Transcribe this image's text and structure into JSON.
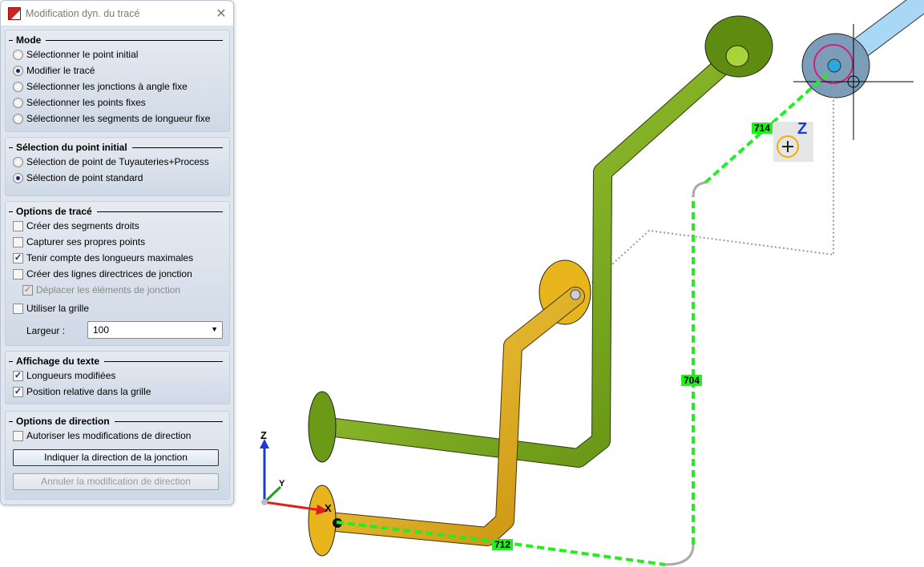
{
  "dialog": {
    "title": "Modification dyn. du tracé",
    "close_icon": "close-icon"
  },
  "mode": {
    "title": "Mode",
    "options": [
      {
        "label": "Sélectionner le point initial",
        "selected": false
      },
      {
        "label": "Modifier le tracé",
        "selected": true
      },
      {
        "label": "Sélectionner les jonctions à angle fixe",
        "selected": false
      },
      {
        "label": "Sélectionner les points fixes",
        "selected": false
      },
      {
        "label": "Sélectionner les segments de longueur fixe",
        "selected": false
      }
    ]
  },
  "initial_point": {
    "title": "Sélection du point initial",
    "options": [
      {
        "label": "Sélection de point de Tuyauteries+Process",
        "selected": false
      },
      {
        "label": "Sélection de point standard",
        "selected": true
      }
    ]
  },
  "route_options": {
    "title": "Options de tracé",
    "checkboxes": [
      {
        "label": "Créer des segments droits",
        "checked": false
      },
      {
        "label": "Capturer ses propres points",
        "checked": false
      },
      {
        "label": "Tenir compte des longueurs maximales",
        "checked": true
      },
      {
        "label": "Créer des lignes directrices de jonction",
        "checked": false
      },
      {
        "label": "Déplacer les éléments de jonction",
        "checked": true,
        "disabled": true
      },
      {
        "label": "Utiliser la grille",
        "checked": false
      }
    ],
    "width_label": "Largeur :",
    "width_value": "100"
  },
  "text_display": {
    "title": "Affichage du texte",
    "checkboxes": [
      {
        "label": "Longueurs modifiées",
        "checked": true
      },
      {
        "label": "Position relative dans la grille",
        "checked": true
      }
    ]
  },
  "direction": {
    "title": "Options de direction",
    "checkbox": {
      "label": "Autoriser les modifications de direction",
      "checked": false
    },
    "indicate_button": "Indiquer la direction de la jonction",
    "cancel_button": "Annuler la modification de direction"
  },
  "viewport": {
    "dimensions": [
      "714",
      "704",
      "712"
    ],
    "axes": {
      "x": "X",
      "y": "Y",
      "z": "Z"
    },
    "snap_label": "Z",
    "colors": {
      "green_pipe": "#7fb21e",
      "yellow_pipe": "#e8b51c",
      "blue_pipe": "#a8d8f5",
      "dim_line": "#22ee22"
    }
  }
}
